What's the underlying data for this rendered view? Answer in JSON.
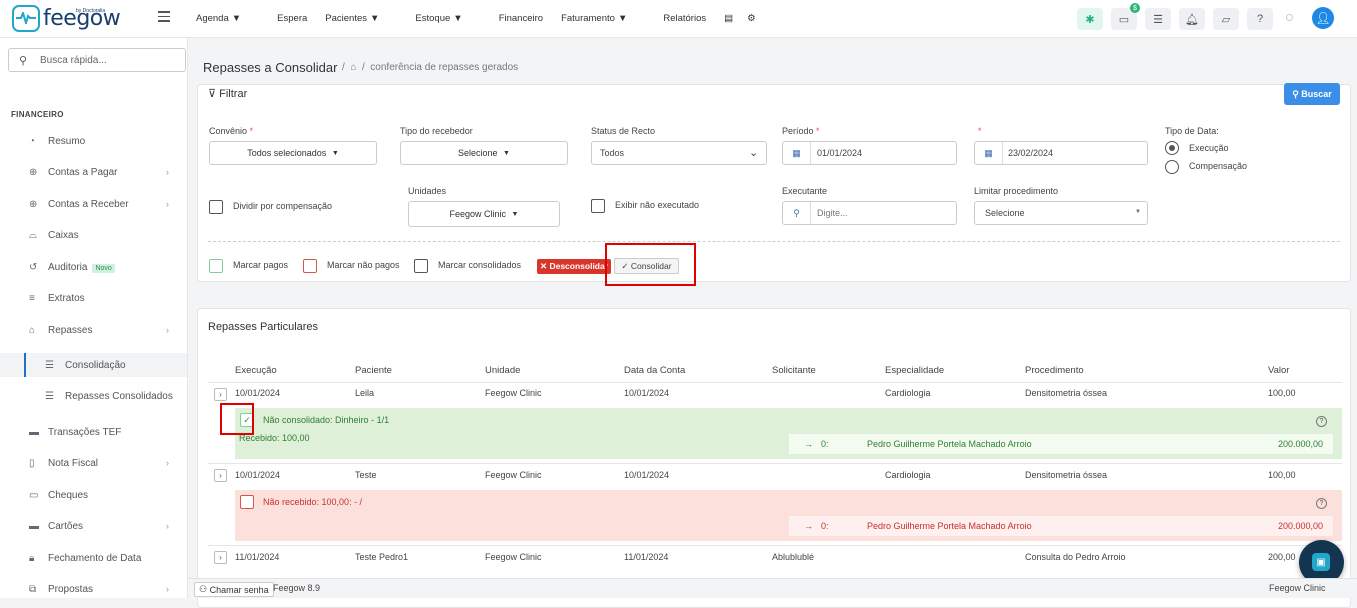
{
  "brand": {
    "name": "feegow",
    "sub": "by Doctoralia"
  },
  "nav": [
    {
      "label": "Agenda",
      "caret": true
    },
    {
      "label": "Espera",
      "caret": false
    },
    {
      "label": "Pacientes",
      "caret": true
    },
    {
      "label": "Estoque",
      "caret": true
    },
    {
      "label": "Financeiro",
      "caret": false
    },
    {
      "label": "Faturamento",
      "caret": true
    },
    {
      "label": "Relatórios",
      "caret": false
    }
  ],
  "topbar": {
    "dollar_badge": "$"
  },
  "sidebar": {
    "search_placeholder": "Busca rápida...",
    "section": "FINANCEIRO",
    "items": [
      {
        "label": "Resumo",
        "icon": "pie-chart-icon"
      },
      {
        "label": "Contas a Pagar",
        "icon": "arrow-up-circle-icon",
        "chevron": true
      },
      {
        "label": "Contas a Receber",
        "icon": "arrow-down-circle-icon",
        "chevron": true
      },
      {
        "label": "Caixas",
        "icon": "inbox-icon"
      },
      {
        "label": "Auditoria",
        "icon": "history-icon",
        "badge": "Novo"
      },
      {
        "label": "Extratos",
        "icon": "list-icon"
      },
      {
        "label": "Repasses",
        "icon": "handshake-icon",
        "chevron": true
      },
      {
        "label": "Consolidação",
        "icon": "list-check-icon",
        "sub": true,
        "active": true
      },
      {
        "label": "Repasses Consolidados",
        "icon": "list-check-icon",
        "sub": true
      },
      {
        "label": "Transações TEF",
        "icon": "card-icon"
      },
      {
        "label": "Nota Fiscal",
        "icon": "document-icon",
        "chevron": true
      },
      {
        "label": "Cheques",
        "icon": "cheque-icon"
      },
      {
        "label": "Cartões",
        "icon": "credit-card-icon",
        "chevron": true
      },
      {
        "label": "Fechamento de Data",
        "icon": "lock-icon"
      },
      {
        "label": "Propostas",
        "icon": "copy-icon",
        "chevron": true
      }
    ]
  },
  "page": {
    "title": "Repasses a Consolidar",
    "breadcrumb": "conferência de repasses gerados"
  },
  "filter": {
    "title": "Filtrar",
    "search_button": "Buscar",
    "convenio_label": "Convênio",
    "convenio_value": "Todos selecionados",
    "tipo_receb_label": "Tipo do recebedor",
    "tipo_receb_value": "Selecione",
    "status_label": "Status de Recto",
    "status_value": "Todos",
    "periodo_label": "Período",
    "date_from": "01/01/2024",
    "date_to": "23/02/2024",
    "tipo_data_label": "Tipo de Data:",
    "tipo_data_options": [
      "Execução",
      "Compensação"
    ],
    "dividir_label": "Dividir por compensação",
    "unidades_label": "Unidades",
    "unidades_value": "Feegow Clinic",
    "exibir_label": "Exibir não executado",
    "executante_label": "Executante",
    "executante_placeholder": "Digite...",
    "limitar_label": "Limitar procedimento",
    "limitar_value": "Selecione"
  },
  "actions": {
    "marcar_pagos": "Marcar pagos",
    "marcar_nao_pagos": "Marcar não pagos",
    "marcar_consolidados": "Marcar consolidados",
    "desconsolidar": "✕ Desconsolidar",
    "consolidar": "Consolidar"
  },
  "table": {
    "title": "Repasses Particulares",
    "headers": [
      "Execução",
      "Paciente",
      "Unidade",
      "Data da Conta",
      "Solicitante",
      "Especialidade",
      "Procedimento",
      "Valor"
    ],
    "rows": [
      {
        "exec": "10/01/2024",
        "paciente": "Leila",
        "unidade": "Feegow Clinic",
        "data": "10/01/2024",
        "solicitante": "",
        "especialidade": "Cardiologia",
        "procedimento": "Densitometria óssea",
        "valor": "100,00"
      },
      {
        "exec": "10/01/2024",
        "paciente": "Teste",
        "unidade": "Feegow Clinic",
        "data": "10/01/2024",
        "solicitante": "",
        "especialidade": "Cardiologia",
        "procedimento": "Densitometria óssea",
        "valor": "100,00"
      },
      {
        "exec": "11/01/2024",
        "paciente": "Teste Pedro1",
        "unidade": "Feegow Clinic",
        "data": "11/01/2024",
        "solicitante": "Ablublublé",
        "especialidade": "",
        "procedimento": "Consulta do Pedro Arroio",
        "valor": "200,00"
      }
    ],
    "detail1": {
      "status": "Não consolidado: Dinheiro - 1/1",
      "recebido": "Recebido: 100,00",
      "arrow": "→",
      "num": "0:",
      "name": "Pedro Guilherme Portela Machado Arroio",
      "valor": "200.000,00"
    },
    "detail2": {
      "status": "Não recebido: 100,00: - /",
      "arrow": "→",
      "num": "0:",
      "name": "Pedro Guilherme Portela Machado Arroio",
      "valor": "200.000,00"
    }
  },
  "footer": {
    "chamar": "Chamar senha",
    "version": "Feegow 8.9",
    "clinic": "Feegow Clinic"
  }
}
